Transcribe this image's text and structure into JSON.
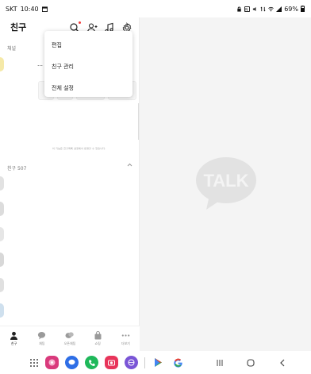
{
  "status_bar": {
    "carrier": "SKT",
    "time": "10:40",
    "battery": "69%"
  },
  "app": {
    "title": "친구",
    "sections": {
      "channel_label": "채널",
      "friends_label": "친구 507"
    },
    "fine_print": "이 기능은 친구목록 설정에서 변경할 수 있습니다."
  },
  "popup_menu": {
    "items": [
      "편집",
      "친구 관리",
      "전체 설정"
    ]
  },
  "tabs": [
    {
      "label": "친구",
      "icon": "person-icon",
      "active": true
    },
    {
      "label": "채팅",
      "icon": "chat-bubble-icon",
      "active": false
    },
    {
      "label": "오픈채팅",
      "icon": "open-chat-icon",
      "active": false
    },
    {
      "label": "쇼핑",
      "icon": "shopping-bag-icon",
      "active": false
    },
    {
      "label": "더보기",
      "icon": "more-icon",
      "active": false
    }
  ],
  "right_pane": {
    "logo_text": "TALK"
  },
  "colors": {
    "logo": "#e2e2e2",
    "accent_red": "#f23c3c",
    "background": "#f4f4f4"
  },
  "dock": {
    "apps": [
      "apps-grid-icon",
      "blossom-app-icon",
      "messages-icon",
      "phone-icon",
      "camera-icon",
      "internet-icon",
      "play-store-icon",
      "google-icon"
    ]
  }
}
